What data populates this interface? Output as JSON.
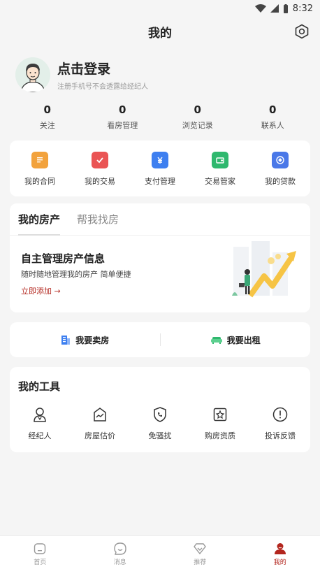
{
  "status": {
    "time": "8:32"
  },
  "header": {
    "title": "我的"
  },
  "profile": {
    "login": "点击登录",
    "subtitle": "注册手机号不会透露给经纪人"
  },
  "stats": [
    {
      "num": "0",
      "label": "关注"
    },
    {
      "num": "0",
      "label": "看房管理"
    },
    {
      "num": "0",
      "label": "浏览记录"
    },
    {
      "num": "0",
      "label": "联系人"
    }
  ],
  "quick": [
    {
      "label": "我的合同",
      "icon": "contract-icon",
      "color": "#f2a23c"
    },
    {
      "label": "我的交易",
      "icon": "trade-icon",
      "color": "#ea5454"
    },
    {
      "label": "支付管理",
      "icon": "payment-icon",
      "color": "#3d7ff0"
    },
    {
      "label": "交易管家",
      "icon": "wallet-icon",
      "color": "#2fb86e"
    },
    {
      "label": "我的贷款",
      "icon": "loan-icon",
      "color": "#4a78e8"
    }
  ],
  "property": {
    "tab_active": "我的房产",
    "tab_inactive": "帮我找房",
    "title": "自主管理房产信息",
    "desc": "随时随地管理我的房产 简单便捷",
    "add": "立即添加 →"
  },
  "sellrent": {
    "sell": "我要卖房",
    "rent": "我要出租"
  },
  "tools": {
    "title": "我的工具",
    "items": [
      {
        "label": "经纪人",
        "icon": "agent-icon"
      },
      {
        "label": "房屋估价",
        "icon": "valuation-icon"
      },
      {
        "label": "免骚扰",
        "icon": "no-disturb-icon"
      },
      {
        "label": "购房资质",
        "icon": "qualification-icon"
      },
      {
        "label": "投诉反馈",
        "icon": "feedback-icon"
      }
    ]
  },
  "tabbar": [
    {
      "label": "首页",
      "icon": "home-icon"
    },
    {
      "label": "消息",
      "icon": "message-icon"
    },
    {
      "label": "推荐",
      "icon": "recommend-icon"
    },
    {
      "label": "我的",
      "icon": "profile-icon"
    }
  ],
  "colors": {
    "accent": "#b3261e",
    "background": "#f5f5f5"
  }
}
